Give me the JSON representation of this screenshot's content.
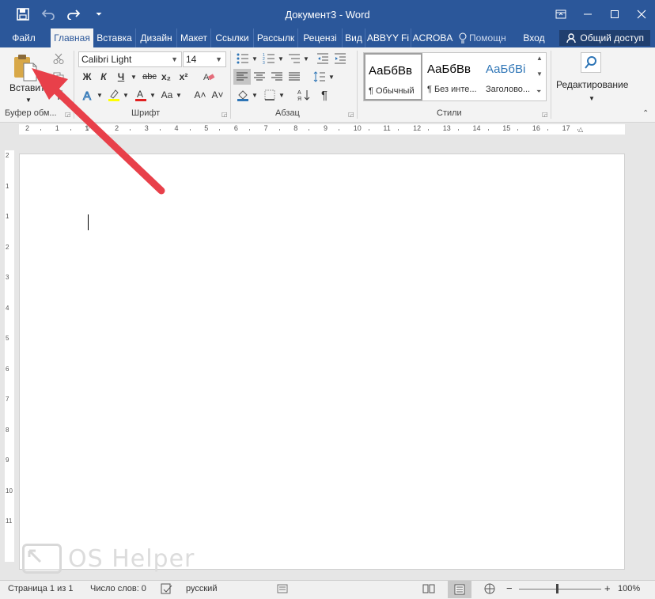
{
  "window": {
    "title": "Документ3 - Word"
  },
  "tabs": [
    {
      "label": "Файл"
    },
    {
      "label": "Главная"
    },
    {
      "label": "Вставка"
    },
    {
      "label": "Дизайн"
    },
    {
      "label": "Макет"
    },
    {
      "label": "Ссылки"
    },
    {
      "label": "Рассылк"
    },
    {
      "label": "Рецензі"
    },
    {
      "label": "Вид"
    },
    {
      "label": "ABBYY Fi"
    },
    {
      "label": "ACROBA"
    },
    {
      "label": "Помощн"
    },
    {
      "label": "Вход"
    }
  ],
  "share_label": "Общий доступ",
  "ribbon": {
    "clipboard": {
      "paste_label": "Вставить",
      "group_label": "Буфер обм..."
    },
    "font": {
      "font_name": "Calibri Light",
      "font_size": "14",
      "group_label": "Шрифт",
      "bold": "Ж",
      "italic": "К",
      "underline": "Ч",
      "strike": "abc",
      "subscript": "x₂",
      "superscript": "x²",
      "grow": "A˄",
      "shrink": "A˅",
      "case": "Aa"
    },
    "paragraph": {
      "group_label": "Абзац",
      "pilcrow": "¶"
    },
    "styles": {
      "group_label": "Стили",
      "items": [
        {
          "sample": "АаБбВв",
          "name": "¶ Обычный"
        },
        {
          "sample": "АаБбВв",
          "name": "¶ Без инте..."
        },
        {
          "sample": "АаБбВі",
          "name": "Заголово..."
        }
      ]
    },
    "editing": {
      "label": "Редактирование"
    }
  },
  "ruler": {
    "ticks": [
      "2",
      "1",
      "1",
      "2",
      "3",
      "4",
      "5",
      "6",
      "7",
      "8",
      "9",
      "10",
      "11",
      "12",
      "13",
      "14",
      "15",
      "16",
      "17"
    ],
    "vticks": [
      "2",
      "1",
      "1",
      "2",
      "3",
      "4",
      "5",
      "6",
      "7",
      "8",
      "9",
      "10",
      "11"
    ]
  },
  "status": {
    "page": "Страница 1 из 1",
    "words": "Число слов: 0",
    "language": "русский",
    "zoom": "100%"
  },
  "watermark": {
    "text": "OS Helper"
  },
  "colors": {
    "accent": "#2b579a",
    "arrow": "#e8404a"
  }
}
